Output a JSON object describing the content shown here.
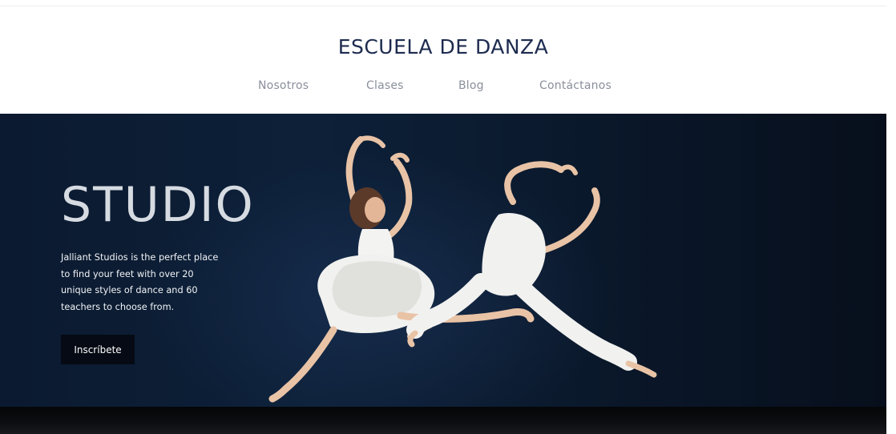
{
  "header": {
    "brand": "ESCUELA DE DANZA",
    "nav": [
      {
        "label": "Nosotros"
      },
      {
        "label": "Clases"
      },
      {
        "label": "Blog"
      },
      {
        "label": "Contáctanos"
      }
    ]
  },
  "hero": {
    "title": "STUDIO",
    "description": "Jalliant Studios is the perfect place to find your feet with over 20 unique styles of dance and 60 teachers to choose from.",
    "cta_label": "Inscríbete",
    "image": "dancers-photo"
  },
  "colors": {
    "brand": "#1d2b4f",
    "nav_text": "#8a8f9b",
    "hero_bg": "#0d2038",
    "button_bg": "#050a14"
  }
}
